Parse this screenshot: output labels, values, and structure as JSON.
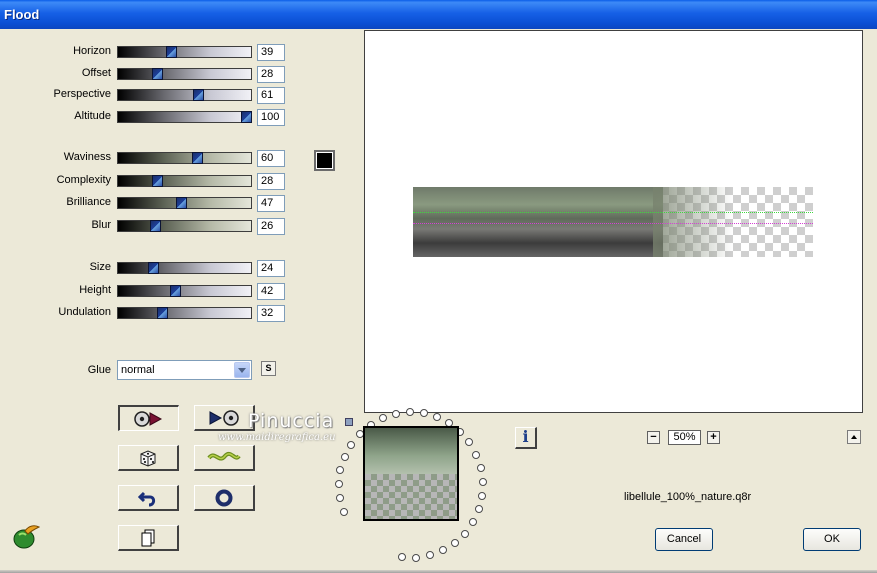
{
  "window": {
    "title": "Flood"
  },
  "sliders": [
    {
      "label": "Horizon",
      "value": "39",
      "fraction": 0.39,
      "style": "gray"
    },
    {
      "label": "Offset",
      "value": "28",
      "fraction": 0.28,
      "style": "gray"
    },
    {
      "label": "Perspective",
      "value": "61",
      "fraction": 0.61,
      "style": "gray"
    },
    {
      "label": "Altitude",
      "value": "100",
      "fraction": 1.0,
      "style": "gray"
    },
    {
      "label": "Waviness",
      "value": "60",
      "fraction": 0.6,
      "style": "green"
    },
    {
      "label": "Complexity",
      "value": "28",
      "fraction": 0.28,
      "style": "green"
    },
    {
      "label": "Brilliance",
      "value": "47",
      "fraction": 0.47,
      "style": "green"
    },
    {
      "label": "Blur",
      "value": "26",
      "fraction": 0.26,
      "style": "green"
    },
    {
      "label": "Size",
      "value": "24",
      "fraction": 0.24,
      "style": "gray"
    },
    {
      "label": "Height",
      "value": "42",
      "fraction": 0.42,
      "style": "gray"
    },
    {
      "label": "Undulation",
      "value": "32",
      "fraction": 0.32,
      "style": "gray"
    }
  ],
  "color_swatch": "#000000",
  "glue": {
    "label": "Glue",
    "value": "normal"
  },
  "glue_small_button": "S",
  "tool_buttons": [
    {
      "name": "reset-left-button",
      "icon": "disc-arrow-icon"
    },
    {
      "name": "reset-right-button",
      "icon": "arrow-disc-icon"
    },
    {
      "name": "random-button",
      "icon": "dice-icon"
    },
    {
      "name": "wave-button",
      "icon": "wave-icon"
    },
    {
      "name": "undo-button",
      "icon": "undo-arrow-icon"
    },
    {
      "name": "ring-button",
      "icon": "ring-icon"
    },
    {
      "name": "copy-button",
      "icon": "copy-pages-icon"
    }
  ],
  "watermark": {
    "name": "Pinuccia",
    "url": "www.maidiregrafica.eu"
  },
  "info_button": "i",
  "zoom": {
    "minus": "−",
    "value": "50%",
    "plus": "+"
  },
  "filename": "libellule_100%_nature.q8r",
  "buttons": {
    "cancel": "Cancel",
    "ok": "OK"
  }
}
